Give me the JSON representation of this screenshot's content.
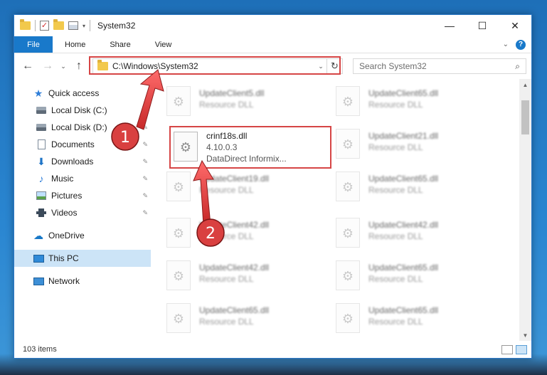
{
  "window": {
    "title": "System32",
    "qa_dropdown": "▾",
    "controls": {
      "minimize": "—",
      "maximize": "☐",
      "close": "✕"
    }
  },
  "ribbon": {
    "file": "File",
    "tabs": [
      "Home",
      "Share",
      "View"
    ],
    "expand": "⌄",
    "help": "?"
  },
  "nav": {
    "back": "←",
    "forward": "→",
    "recent": "⌄",
    "up": "↑",
    "address": "C:\\Windows\\System32",
    "address_dd": "⌄",
    "refresh": "↻",
    "search_placeholder": "Search System32",
    "search_icon": "⌕"
  },
  "sidebar": {
    "quick_access": "Quick access",
    "pinned": [
      {
        "label": "Local Disk (C:)",
        "icon": "drive-icon"
      },
      {
        "label": "Local Disk (D:)",
        "icon": "drive-icon"
      },
      {
        "label": "Documents",
        "icon": "documents-icon"
      },
      {
        "label": "Downloads",
        "icon": "downloads-icon"
      },
      {
        "label": "Music",
        "icon": "music-icon"
      },
      {
        "label": "Pictures",
        "icon": "pictures-icon"
      },
      {
        "label": "Videos",
        "icon": "videos-icon"
      }
    ],
    "pin_glyph": "✎",
    "onedrive": "OneDrive",
    "this_pc": "This PC",
    "network": "Network"
  },
  "files": {
    "left": [
      {
        "name": "UpdateClient5.dll",
        "sub": "Resource DLL"
      },
      {
        "name": "crinf18s.dll",
        "sub": "4.10.0.3",
        "sub2": "DataDirect Informix..."
      },
      {
        "name": "UpdateClient19.dll",
        "sub": "Resource DLL"
      },
      {
        "name": "UpdateClient42.dll",
        "sub": "Resource DLL"
      },
      {
        "name": "UpdateClient42.dll",
        "sub": "Resource DLL"
      },
      {
        "name": "UpdateClient65.dll",
        "sub": "Resource DLL"
      }
    ],
    "right": [
      {
        "name": "UpdateClient65.dll",
        "sub": "Resource DLL"
      },
      {
        "name": "UpdateClient21.dll",
        "sub": "Resource DLL"
      },
      {
        "name": "UpdateClient65.dll",
        "sub": "Resource DLL"
      },
      {
        "name": "UpdateClient42.dll",
        "sub": "Resource DLL"
      },
      {
        "name": "UpdateClient65.dll",
        "sub": "Resource DLL"
      },
      {
        "name": "UpdateClient65.dll",
        "sub": "Resource DLL"
      }
    ],
    "gear_glyph": "⚙"
  },
  "status": {
    "count": "103 items"
  },
  "annotations": {
    "step1": "1",
    "step2": "2"
  },
  "colors": {
    "accent": "#1979ca",
    "highlight": "#d64545",
    "arrow": "#e04040"
  }
}
